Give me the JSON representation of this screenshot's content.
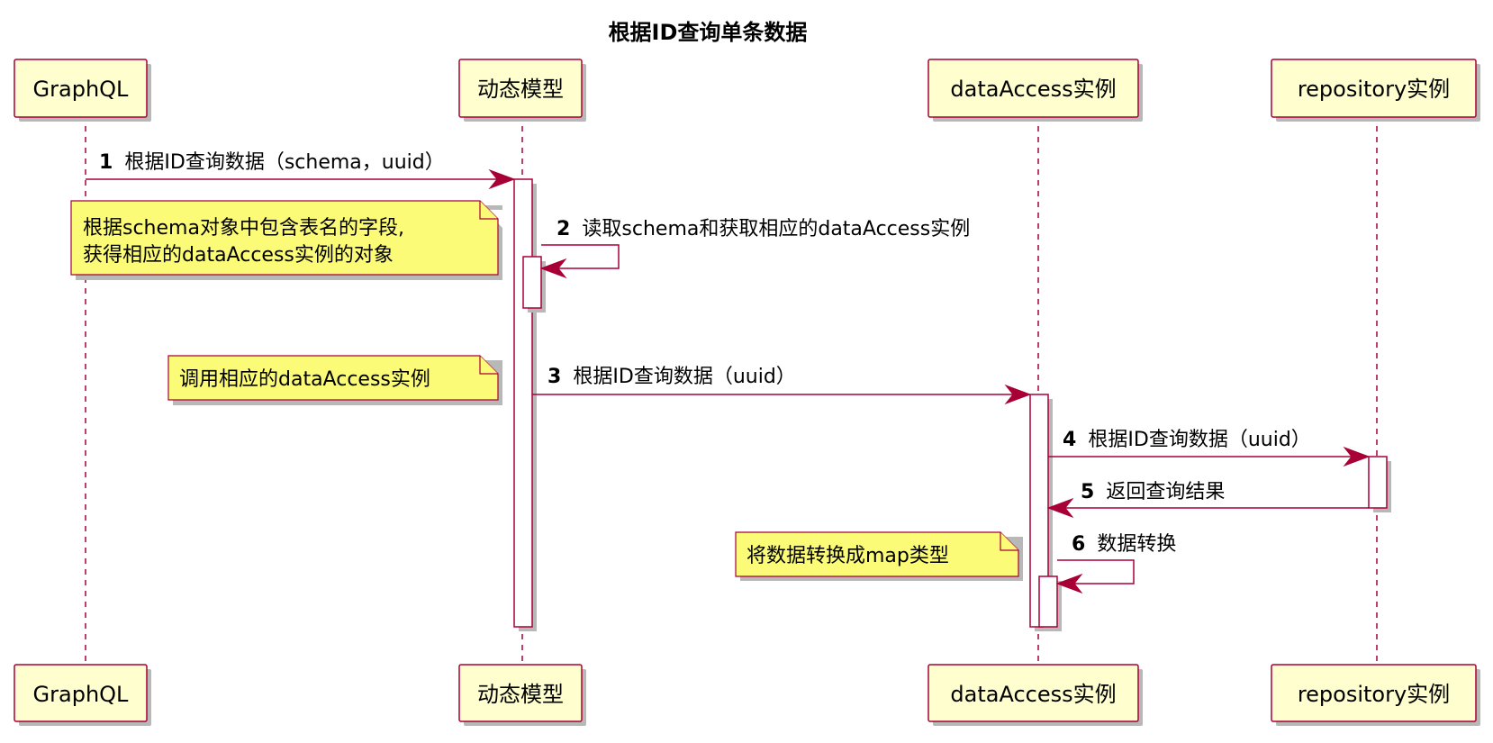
{
  "title": "根据ID查询单条数据",
  "participants": [
    {
      "id": "graphql",
      "label": "GraphQL"
    },
    {
      "id": "model",
      "label": "动态模型"
    },
    {
      "id": "dataaccess",
      "label": "dataAccess实例"
    },
    {
      "id": "repository",
      "label": "repository实例"
    }
  ],
  "messages": [
    {
      "num": "1",
      "text": "根据ID查询数据（schema，uuid）"
    },
    {
      "num": "2",
      "text": "读取schema和获取相应的dataAccess实例"
    },
    {
      "num": "3",
      "text": "根据ID查询数据（uuid）"
    },
    {
      "num": "4",
      "text": "根据ID查询数据（uuid）"
    },
    {
      "num": "5",
      "text": "返回查询结果"
    },
    {
      "num": "6",
      "text": "数据转换"
    }
  ],
  "notes": [
    {
      "lines": [
        "根据schema对象中包含表名的字段,",
        "获得相应的dataAccess实例的对象"
      ]
    },
    {
      "lines": [
        "调用相应的dataAccess实例"
      ]
    },
    {
      "lines": [
        "将数据转换成map类型"
      ]
    }
  ],
  "colors": {
    "participant_fill": "#FEFECE",
    "border": "#A80036",
    "note_fill": "#FBFB77"
  }
}
